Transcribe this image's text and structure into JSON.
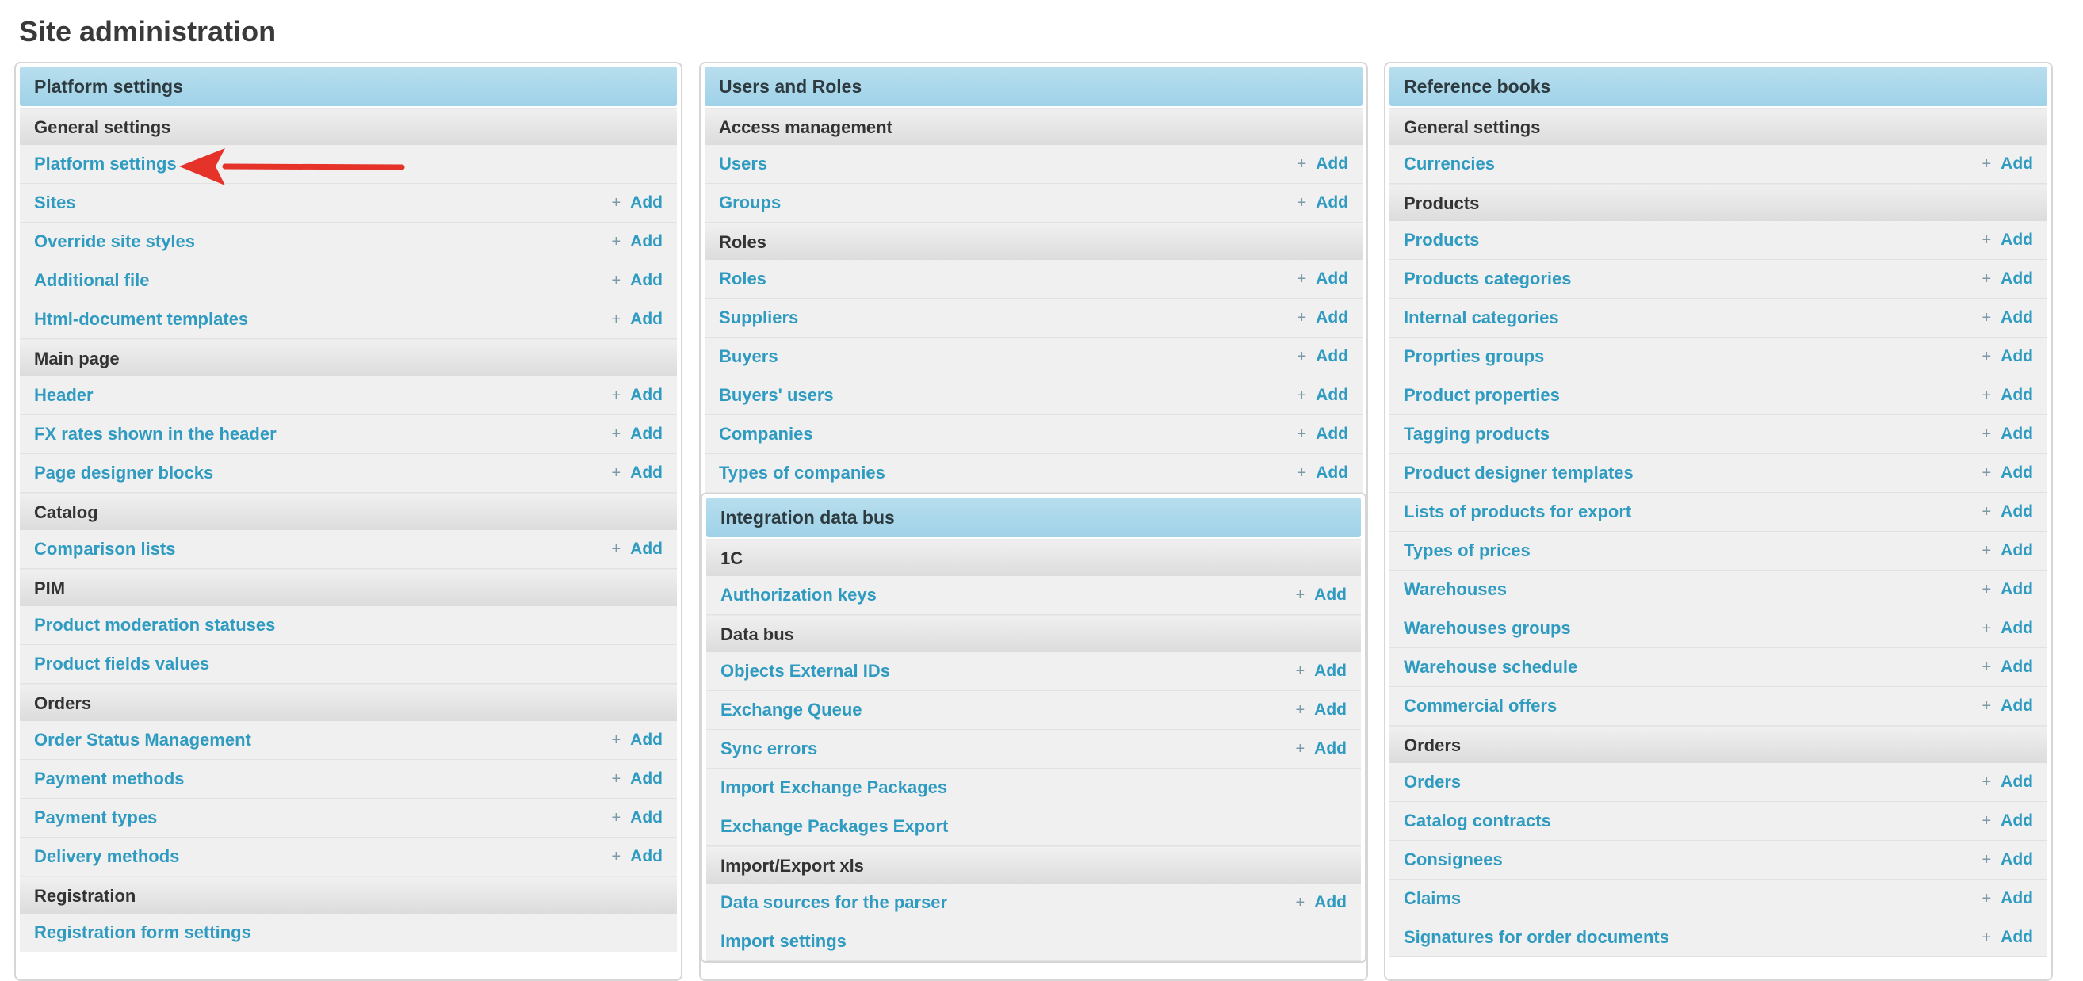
{
  "title": "Site administration",
  "add_label": "Add",
  "accent_color": "#2f9bc1",
  "header_color": "#a9d8ec",
  "columns": [
    [
      {
        "title": "Platform settings",
        "groups": [
          {
            "name": "General settings",
            "items": [
              {
                "label": "Platform settings",
                "add": false
              },
              {
                "label": "Sites",
                "add": true
              },
              {
                "label": "Override site styles",
                "add": true
              },
              {
                "label": "Additional file",
                "add": true
              },
              {
                "label": "Html-document templates",
                "add": true
              }
            ]
          },
          {
            "name": "Main page",
            "items": [
              {
                "label": "Header",
                "add": true
              },
              {
                "label": "FX rates shown in the header",
                "add": true
              },
              {
                "label": "Page designer blocks",
                "add": true
              }
            ]
          },
          {
            "name": "Catalog",
            "items": [
              {
                "label": "Comparison lists",
                "add": true
              }
            ]
          },
          {
            "name": "PIM",
            "items": [
              {
                "label": "Product moderation statuses",
                "add": false
              },
              {
                "label": "Product fields values",
                "add": false
              }
            ]
          },
          {
            "name": "Orders",
            "items": [
              {
                "label": "Order Status Management",
                "add": true
              },
              {
                "label": "Payment methods",
                "add": true
              },
              {
                "label": "Payment types",
                "add": true
              },
              {
                "label": "Delivery methods",
                "add": true
              }
            ]
          },
          {
            "name": "Registration",
            "items": [
              {
                "label": "Registration form settings",
                "add": false
              }
            ]
          }
        ]
      }
    ],
    [
      {
        "title": "Users and Roles",
        "groups": [
          {
            "name": "Access management",
            "items": [
              {
                "label": "Users",
                "add": true
              },
              {
                "label": "Groups",
                "add": true
              }
            ]
          },
          {
            "name": "Roles",
            "items": [
              {
                "label": "Roles",
                "add": true
              },
              {
                "label": "Suppliers",
                "add": true
              },
              {
                "label": "Buyers",
                "add": true
              },
              {
                "label": "Buyers' users",
                "add": true
              },
              {
                "label": "Companies",
                "add": true
              },
              {
                "label": "Types of companies",
                "add": true
              }
            ]
          }
        ]
      },
      {
        "title": "Integration data bus",
        "groups": [
          {
            "name": "1C",
            "items": [
              {
                "label": "Authorization keys",
                "add": true
              }
            ]
          },
          {
            "name": "Data bus",
            "items": [
              {
                "label": "Objects External IDs",
                "add": true
              },
              {
                "label": "Exchange Queue",
                "add": true
              },
              {
                "label": "Sync errors",
                "add": true
              },
              {
                "label": "Import Exchange Packages",
                "add": false
              },
              {
                "label": "Exchange Packages Export",
                "add": false
              }
            ]
          },
          {
            "name": "Import/Export xls",
            "items": [
              {
                "label": "Data sources for the parser",
                "add": true
              },
              {
                "label": "Import settings",
                "add": false
              }
            ]
          }
        ]
      }
    ],
    [
      {
        "title": "Reference books",
        "groups": [
          {
            "name": "General settings",
            "items": [
              {
                "label": "Currencies",
                "add": true
              }
            ]
          },
          {
            "name": "Products",
            "items": [
              {
                "label": "Products",
                "add": true
              },
              {
                "label": "Products categories",
                "add": true
              },
              {
                "label": "Internal categories",
                "add": true
              },
              {
                "label": "Proprties groups",
                "add": true
              },
              {
                "label": "Product properties",
                "add": true
              },
              {
                "label": "Tagging products",
                "add": true
              },
              {
                "label": "Product designer templates",
                "add": true
              },
              {
                "label": "Lists of products for export",
                "add": true
              },
              {
                "label": "Types of prices",
                "add": true
              },
              {
                "label": "Warehouses",
                "add": true
              },
              {
                "label": "Warehouses groups",
                "add": true
              },
              {
                "label": "Warehouse schedule",
                "add": true
              },
              {
                "label": "Commercial offers",
                "add": true
              }
            ]
          },
          {
            "name": "Orders",
            "items": [
              {
                "label": "Orders",
                "add": true
              },
              {
                "label": "Catalog contracts",
                "add": true
              },
              {
                "label": "Consignees",
                "add": true
              },
              {
                "label": "Claims",
                "add": true
              },
              {
                "label": "Signatures for order documents",
                "add": true
              }
            ]
          }
        ]
      }
    ]
  ]
}
